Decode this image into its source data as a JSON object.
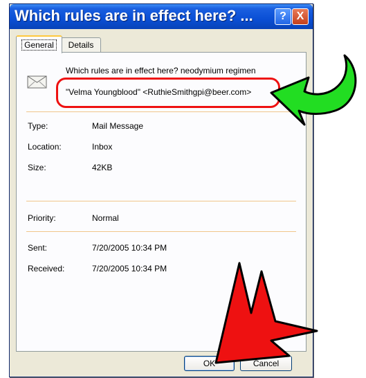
{
  "window": {
    "title": "Which rules are in effect here? ...",
    "help_glyph": "?",
    "close_glyph": "X"
  },
  "tabs": [
    {
      "label": "General",
      "active": true
    },
    {
      "label": "Details",
      "active": false
    }
  ],
  "message": {
    "subject": "Which rules are in effect here? neodymium regimen",
    "from": "\"Velma Youngblood\" <RuthieSmithgpi@beer.com>"
  },
  "properties": {
    "type": {
      "label": "Type:",
      "value": "Mail Message"
    },
    "location": {
      "label": "Location:",
      "value": "Inbox"
    },
    "size": {
      "label": "Size:",
      "value": "42KB"
    },
    "priority": {
      "label": "Priority:",
      "value": "Normal"
    },
    "sent": {
      "label": "Sent:",
      "value": "7/20/2005 10:34 PM"
    },
    "received": {
      "label": "Received:",
      "value": "7/20/2005 10:34 PM"
    }
  },
  "buttons": {
    "ok": "OK",
    "cancel": "Cancel"
  },
  "colors": {
    "highlight_ring": "#ee1111",
    "green_arrow": "#22dd22",
    "red_arrow": "#ee1111",
    "titlebar": "#0a4fd5"
  },
  "icons": {
    "envelope": "envelope-icon",
    "help": "help-icon",
    "close": "close-icon"
  }
}
